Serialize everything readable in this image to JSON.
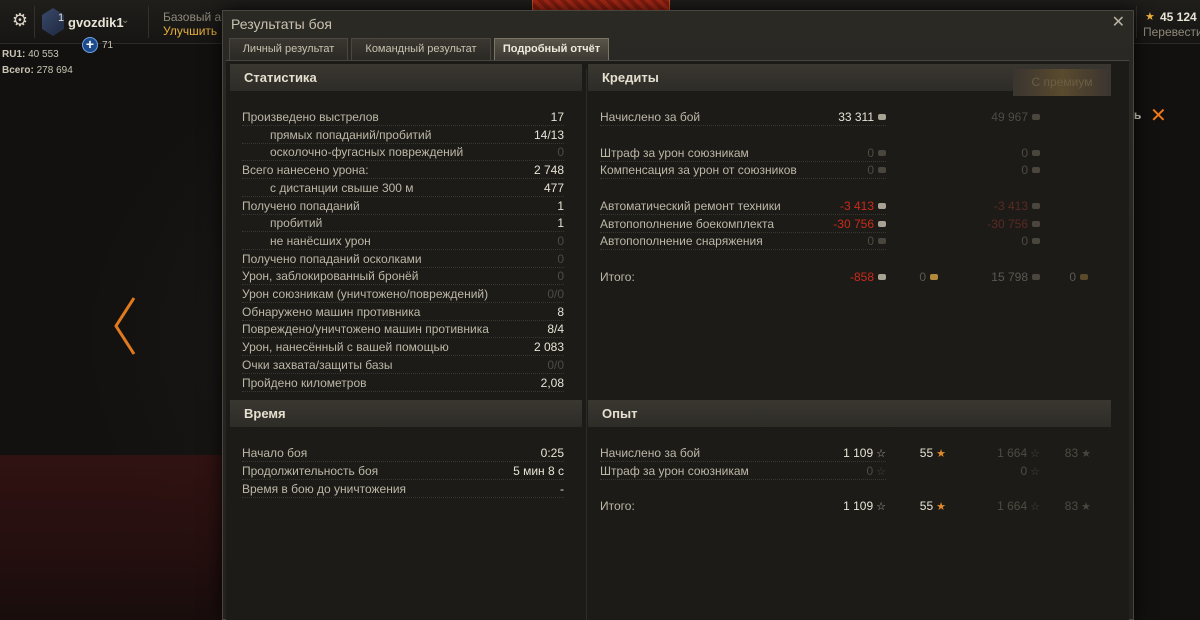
{
  "header": {
    "username": "gvozdik1",
    "rank_badge": "1",
    "plus_count": "71",
    "server_line": "RU1:",
    "server_online": "40 553",
    "total_line": "Всего:",
    "total_online": "278 694",
    "premium_title": "Базовый акк",
    "premium_action": "Улучшить",
    "gold_value": "45 124",
    "gold_action": "Перевести",
    "right_hint": "ть",
    "icons": {
      "settings": "gear-icon",
      "close": "close-icon",
      "left_arrow": "chevron-left-icon"
    }
  },
  "window": {
    "title": "Результаты боя",
    "close_symbol": "✕",
    "tabs": [
      {
        "label": "Личный результат"
      },
      {
        "label": "Командный результат"
      },
      {
        "label": "Подробный отчёт"
      }
    ]
  },
  "statistics": {
    "title": "Статистика",
    "rows": [
      {
        "label": "Произведено выстрелов",
        "value": "17",
        "indent": false,
        "dim": false
      },
      {
        "label": "прямых попаданий/пробитий",
        "value": "14/13",
        "indent": true,
        "dim": false
      },
      {
        "label": "осколочно-фугасных повреждений",
        "value": "0",
        "indent": true,
        "dim": true
      },
      {
        "label": "Всего нанесено урона:",
        "value": "2 748",
        "indent": false,
        "dim": false
      },
      {
        "label": "с дистанции свыше 300 м",
        "value": "477",
        "indent": true,
        "dim": false
      },
      {
        "label": "Получено попаданий",
        "value": "1",
        "indent": false,
        "dim": false
      },
      {
        "label": "пробитий",
        "value": "1",
        "indent": true,
        "dim": false
      },
      {
        "label": "не нанёсших урон",
        "value": "0",
        "indent": true,
        "dim": true
      },
      {
        "label": "Получено попаданий осколками",
        "value": "0",
        "indent": false,
        "dim": true
      },
      {
        "label": "Урон, заблокированный бронёй",
        "value": "0",
        "indent": false,
        "dim": true
      },
      {
        "label": "Урон союзникам (уничтожено/повреждений)",
        "value": "0/0",
        "indent": false,
        "dim": true
      },
      {
        "label": "Обнаружено машин противника",
        "value": "8",
        "indent": false,
        "dim": false
      },
      {
        "label": "Повреждено/уничтожено машин противника",
        "value": "8/4",
        "indent": false,
        "dim": false
      },
      {
        "label": "Урон, нанесённый с вашей помощью",
        "value": "2 083",
        "indent": false,
        "dim": false
      },
      {
        "label": "Очки захвата/защиты базы",
        "value": "0/0",
        "indent": false,
        "dim": true
      },
      {
        "label": "Пройдено километров",
        "value": "2,08",
        "indent": false,
        "dim": false
      }
    ]
  },
  "time": {
    "title": "Время",
    "rows": [
      {
        "label": "Начало боя",
        "value": "0:25"
      },
      {
        "label": "Продолжительность боя",
        "value": "5 мин 8 с"
      },
      {
        "label": "Время в бою до уничтожения",
        "value": "-"
      }
    ]
  },
  "credits": {
    "title": "Кредиты",
    "premium_label": "С премиум",
    "rows": [
      {
        "label": "Начислено за бой",
        "base": "33 311",
        "premium": "49 967",
        "style": "white"
      },
      {
        "label": "Штраф за урон союзникам",
        "base": "0",
        "premium": "0",
        "style": "dim"
      },
      {
        "label": "Компенсация за урон от союзников",
        "base": "0",
        "premium": "0",
        "style": "dim"
      },
      {
        "label": "Автоматический ремонт техники",
        "base": "-3 413",
        "premium": "-3 413",
        "style": "red"
      },
      {
        "label": "Автопополнение боекомплекта",
        "base": "-30 756",
        "premium": "-30 756",
        "style": "red"
      },
      {
        "label": "Автопополнение снаряжения",
        "base": "0",
        "premium": "0",
        "style": "dim"
      }
    ],
    "total": {
      "label": "Итого:",
      "base": "-858",
      "base_gold": "0",
      "premium": "15 798",
      "premium_gold": "0"
    }
  },
  "experience": {
    "title": "Опыт",
    "rows": [
      {
        "label": "Начислено за бой",
        "base": "1 109",
        "free": "55",
        "premium": "1 664",
        "premium_free": "83"
      },
      {
        "label": "Штраф за урон союзникам",
        "base": "0",
        "premium": "0"
      }
    ],
    "total": {
      "label": "Итого:",
      "base": "1 109",
      "free": "55",
      "premium": "1 664",
      "premium_free": "83"
    }
  },
  "colors": {
    "accent_orange": "#e7b03c",
    "negative_red": "#cc2a1a",
    "text_main": "#bdb7a6"
  }
}
